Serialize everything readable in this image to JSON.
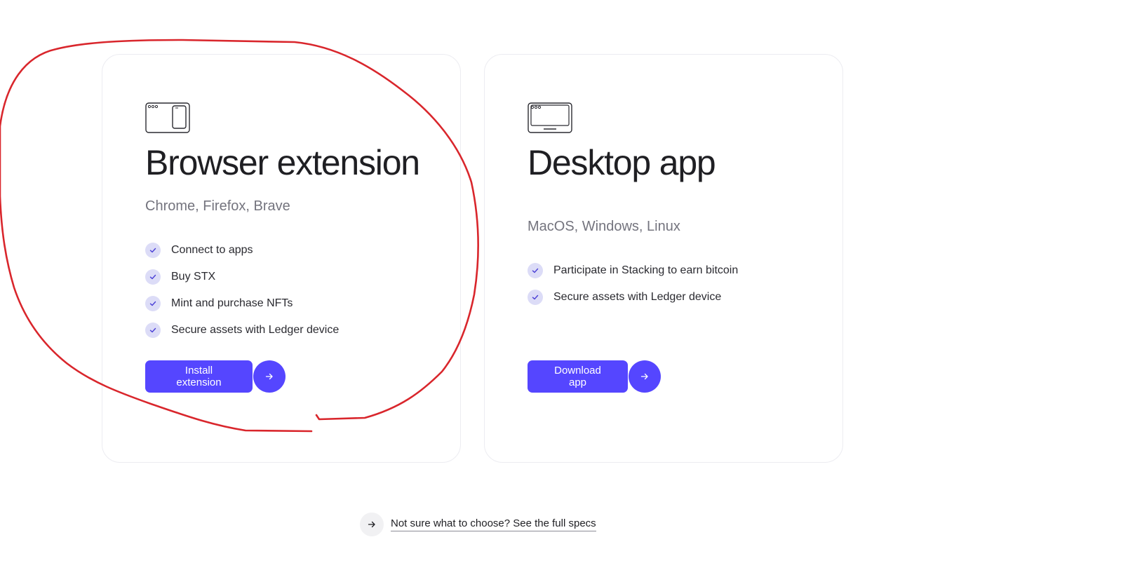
{
  "colors": {
    "accent": "#5546ff",
    "check_bg": "#dcdcf7",
    "annotation": "#d9262c"
  },
  "browser_card": {
    "icon": "browser-window-phone-icon",
    "title": "Browser extension",
    "subtitle": "Chrome, Firefox, Brave",
    "features": [
      "Connect to apps",
      "Buy STX",
      "Mint and purchase NFTs",
      "Secure assets with Ledger device"
    ],
    "cta_label": "Install extension"
  },
  "desktop_card": {
    "icon": "desktop-monitor-icon",
    "title": "Desktop app",
    "subtitle": "MacOS, Windows, Linux",
    "features": [
      "Participate in Stacking to earn bitcoin",
      "Secure assets with Ledger device"
    ],
    "cta_label": "Download app"
  },
  "specs_link": "Not sure what to choose? See the full specs"
}
